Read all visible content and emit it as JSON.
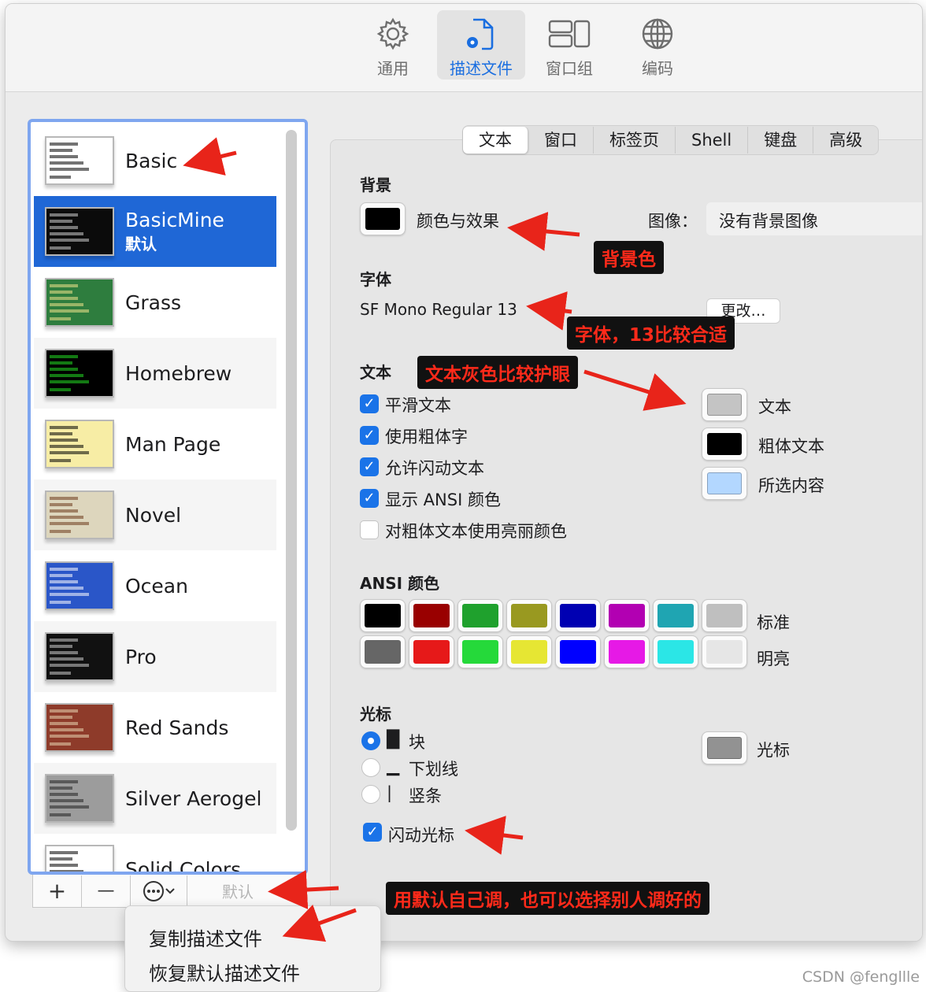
{
  "toolbar": {
    "items": [
      {
        "label": "通用",
        "icon": "gear-icon"
      },
      {
        "label": "描述文件",
        "icon": "profile-document-icon"
      },
      {
        "label": "窗口组",
        "icon": "window-group-icon"
      },
      {
        "label": "编码",
        "icon": "globe-icon"
      }
    ],
    "active_index": 1
  },
  "profiles": [
    {
      "name": "Basic",
      "thumb_bg": "#ffffff",
      "thumb_fg": "#000000"
    },
    {
      "name": "BasicMine",
      "sub": "默认",
      "thumb_bg": "#0b0b0b",
      "thumb_fg": "#d0d0d0",
      "selected": true
    },
    {
      "name": "Grass",
      "thumb_bg": "#2e7d3e",
      "thumb_fg": "#f3e38a"
    },
    {
      "name": "Homebrew",
      "thumb_bg": "#000000",
      "thumb_fg": "#22dd22"
    },
    {
      "name": "Man Page",
      "thumb_bg": "#f7eda5",
      "thumb_fg": "#000000"
    },
    {
      "name": "Novel",
      "thumb_bg": "#ddd6bd",
      "thumb_fg": "#6b3a1c"
    },
    {
      "name": "Ocean",
      "thumb_bg": "#2a56c8",
      "thumb_fg": "#ffffff"
    },
    {
      "name": "Pro",
      "thumb_bg": "#111111",
      "thumb_fg": "#cccccc"
    },
    {
      "name": "Red Sands",
      "thumb_bg": "#8e3b2a",
      "thumb_fg": "#e8d6b0"
    },
    {
      "name": "Silver Aerogel",
      "thumb_bg": "#9c9c9c",
      "thumb_fg": "#222222"
    },
    {
      "name": "Solid Colors",
      "thumb_bg": "#ffffff",
      "thumb_fg": "#000000"
    }
  ],
  "bottom_bar": {
    "add": "+",
    "remove": "—",
    "more": "⊙",
    "default_label": "默认"
  },
  "context_menu": {
    "items": [
      "复制描述文件",
      "恢复默认描述文件"
    ]
  },
  "tabs": [
    "文本",
    "窗口",
    "标签页",
    "Shell",
    "键盘",
    "高级"
  ],
  "active_tab": 0,
  "background": {
    "heading": "背景",
    "color_label": "颜色与效果",
    "color": "#000000",
    "image_label": "图像：",
    "image_value": "没有背景图像"
  },
  "font": {
    "heading": "字体",
    "value": "SF Mono Regular 13",
    "change_button": "更改…"
  },
  "text": {
    "heading": "文本",
    "options": [
      {
        "label": "平滑文本",
        "checked": true
      },
      {
        "label": "使用粗体字",
        "checked": true
      },
      {
        "label": "允许闪动文本",
        "checked": true
      },
      {
        "label": "显示 ANSI 颜色",
        "checked": true
      },
      {
        "label": "对粗体文本使用亮丽颜色",
        "checked": false
      }
    ],
    "colors": [
      {
        "label": "文本",
        "color": "#c4c4c4"
      },
      {
        "label": "粗体文本",
        "color": "#000000"
      },
      {
        "label": "所选内容",
        "color": "#b3d7ff"
      }
    ]
  },
  "ansi": {
    "heading": "ANSI 颜色",
    "normal_label": "标准",
    "bright_label": "明亮",
    "normal": [
      "#000000",
      "#990000",
      "#1fa12d",
      "#999920",
      "#0000b2",
      "#b200b2",
      "#1fa5b2",
      "#bfbfbf"
    ],
    "bright": [
      "#666666",
      "#e61919",
      "#25d93a",
      "#e6e633",
      "#0000ff",
      "#e619e6",
      "#2be6e6",
      "#e6e6e6"
    ]
  },
  "cursor": {
    "heading": "光标",
    "styles": [
      {
        "glyph": "█",
        "label": "块",
        "selected": true
      },
      {
        "glyph": "▁",
        "label": "下划线",
        "selected": false
      },
      {
        "glyph": "|",
        "label": "竖条",
        "selected": false
      }
    ],
    "color_label": "光标",
    "color": "#929292",
    "blink_label": "闪动光标",
    "blink": true
  },
  "annotations": {
    "bg": "背景色",
    "font": "字体，13比较合适",
    "text": "文本灰色比较护眼",
    "default": "用默认自己调，也可以选择别人调好的"
  },
  "watermark": "CSDN @fengllle"
}
